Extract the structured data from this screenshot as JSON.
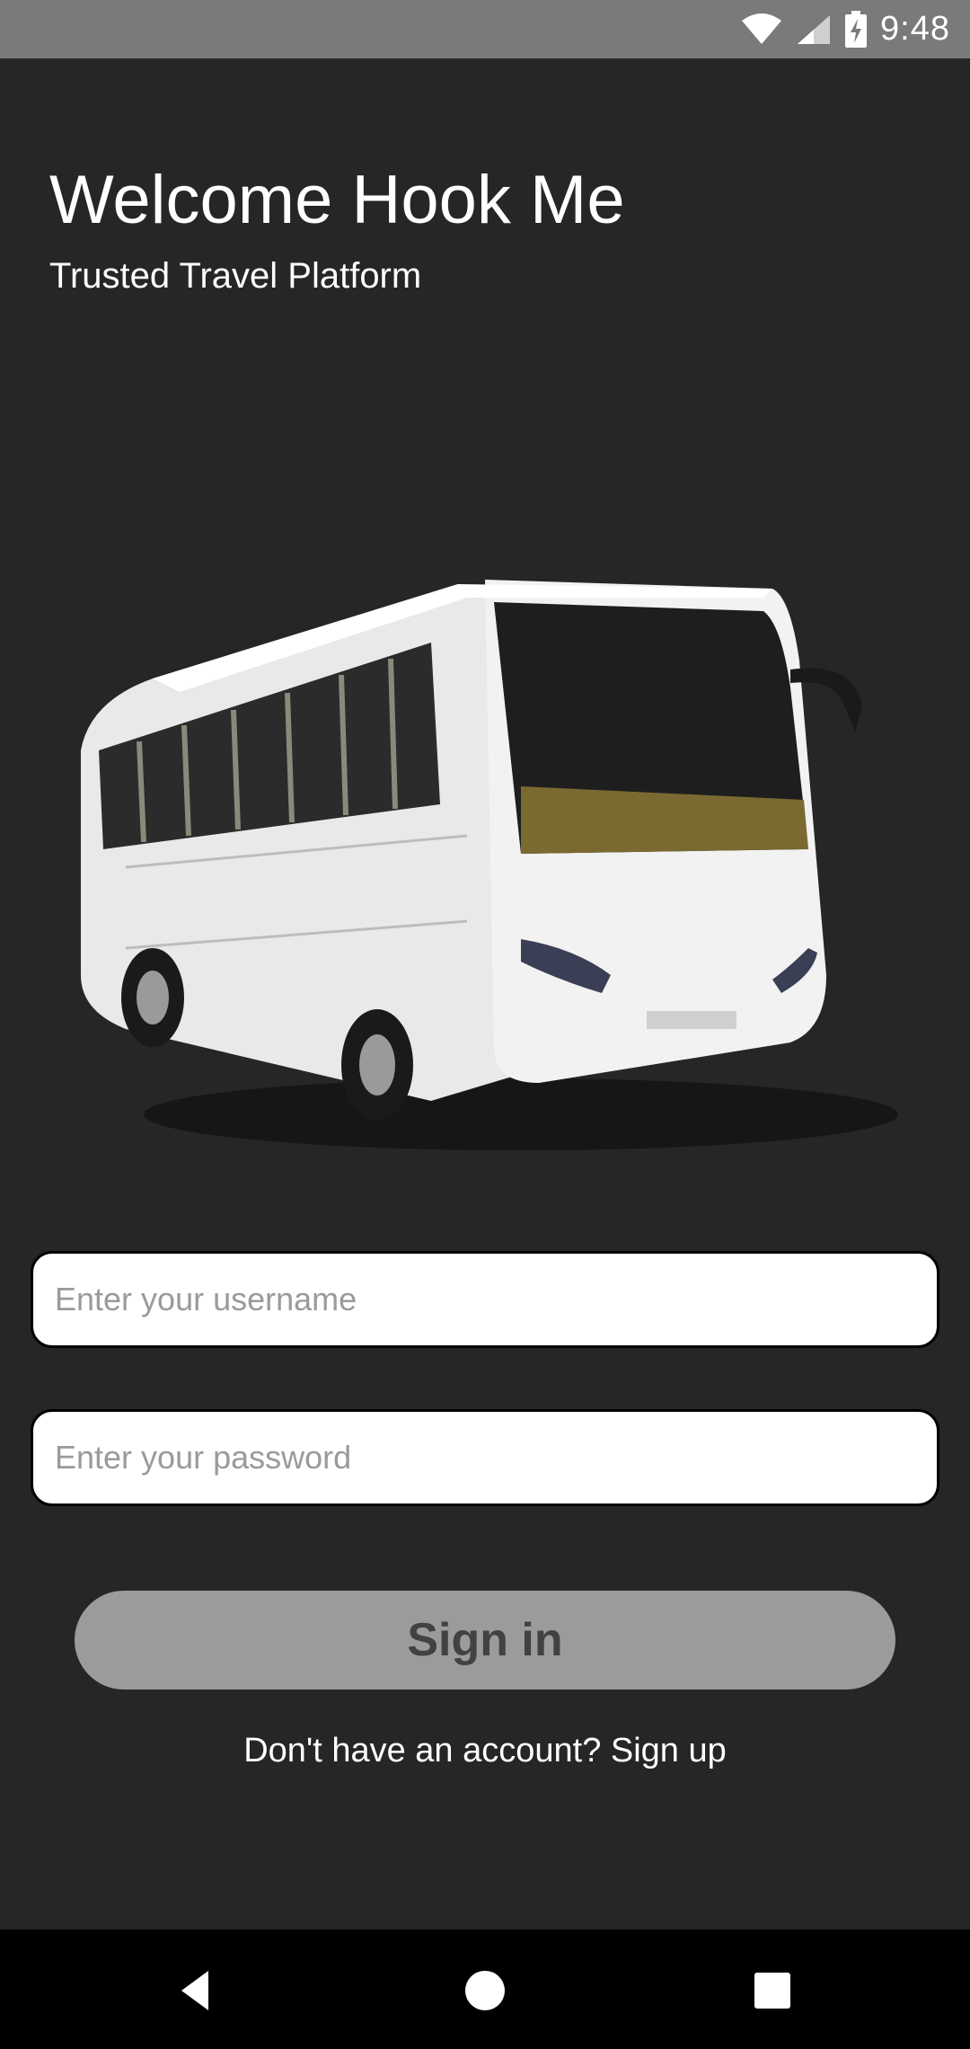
{
  "status_bar": {
    "time": "9:48",
    "icons": [
      "wifi-icon",
      "cell-signal-icon",
      "battery-charging-icon"
    ]
  },
  "header": {
    "title": "Welcome Hook Me",
    "subtitle": "Trusted Travel Platform"
  },
  "hero": {
    "image": "bus-image"
  },
  "form": {
    "username": {
      "value": "",
      "placeholder": "Enter your username"
    },
    "password": {
      "value": "",
      "placeholder": "Enter your password"
    },
    "signin_label": "Sign in",
    "signup_text": "Don't have an account? Sign up"
  },
  "nav_bar": {
    "icons": [
      "back-icon",
      "home-icon",
      "recents-icon"
    ]
  },
  "colors": {
    "background": "#262626",
    "status_bar": "#7a7a7a",
    "button_bg": "#9b9b9b",
    "button_text": "#424242",
    "input_bg": "#ffffff",
    "nav_bar": "#000000"
  }
}
